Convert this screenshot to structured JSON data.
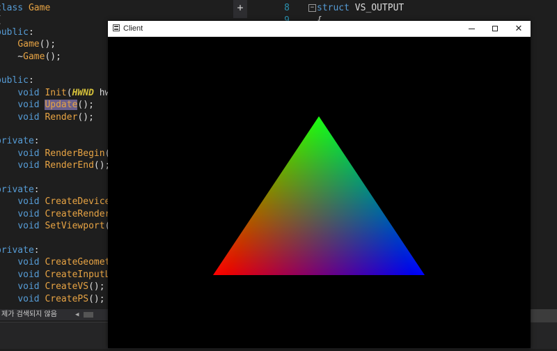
{
  "editor_left": {
    "lines": [
      {
        "segs": [
          {
            "t": "class ",
            "c": "kw"
          },
          {
            "t": "Game",
            "c": "fn"
          }
        ]
      },
      {
        "segs": [
          {
            "t": "{",
            "c": ""
          }
        ]
      },
      {
        "segs": [
          {
            "t": "public",
            "c": "kw"
          },
          {
            "t": ":",
            "c": ""
          }
        ]
      },
      {
        "segs": [
          {
            "t": "    ",
            "c": ""
          },
          {
            "t": "Game",
            "c": "fn"
          },
          {
            "t": "();",
            "c": ""
          }
        ]
      },
      {
        "segs": [
          {
            "t": "    ~",
            "c": ""
          },
          {
            "t": "Game",
            "c": "fn"
          },
          {
            "t": "();",
            "c": ""
          }
        ]
      },
      {
        "segs": []
      },
      {
        "segs": [
          {
            "t": "public",
            "c": "kw"
          },
          {
            "t": ":",
            "c": ""
          }
        ]
      },
      {
        "segs": [
          {
            "t": "    ",
            "c": ""
          },
          {
            "t": "void ",
            "c": "kw"
          },
          {
            "t": "Init",
            "c": "fn"
          },
          {
            "t": "(",
            "c": ""
          },
          {
            "t": "HWND",
            "c": "macro"
          },
          {
            "t": " hwnd",
            "c": ""
          }
        ]
      },
      {
        "segs": [
          {
            "t": "    ",
            "c": ""
          },
          {
            "t": "void ",
            "c": "kw"
          },
          {
            "t": "Update",
            "c": "hl"
          },
          {
            "t": "();",
            "c": ""
          }
        ]
      },
      {
        "segs": [
          {
            "t": "    ",
            "c": ""
          },
          {
            "t": "void ",
            "c": "kw"
          },
          {
            "t": "Render",
            "c": "fn"
          },
          {
            "t": "();",
            "c": ""
          }
        ]
      },
      {
        "segs": []
      },
      {
        "segs": [
          {
            "t": "private",
            "c": "kw"
          },
          {
            "t": ":",
            "c": ""
          }
        ]
      },
      {
        "segs": [
          {
            "t": "    ",
            "c": ""
          },
          {
            "t": "void ",
            "c": "kw"
          },
          {
            "t": "RenderBegin",
            "c": "fn"
          },
          {
            "t": "()",
            "c": ""
          }
        ]
      },
      {
        "segs": [
          {
            "t": "    ",
            "c": ""
          },
          {
            "t": "void ",
            "c": "kw"
          },
          {
            "t": "RenderEnd",
            "c": "fn"
          },
          {
            "t": "();",
            "c": ""
          }
        ]
      },
      {
        "segs": []
      },
      {
        "segs": [
          {
            "t": "private",
            "c": "kw"
          },
          {
            "t": ":",
            "c": ""
          }
        ]
      },
      {
        "segs": [
          {
            "t": "    ",
            "c": ""
          },
          {
            "t": "void ",
            "c": "kw"
          },
          {
            "t": "CreateDeviceA",
            "c": "fn"
          }
        ]
      },
      {
        "segs": [
          {
            "t": "    ",
            "c": ""
          },
          {
            "t": "void ",
            "c": "kw"
          },
          {
            "t": "CreateRenderT",
            "c": "fn"
          }
        ]
      },
      {
        "segs": [
          {
            "t": "    ",
            "c": ""
          },
          {
            "t": "void ",
            "c": "kw"
          },
          {
            "t": "SetViewport",
            "c": "fn"
          },
          {
            "t": "()",
            "c": ""
          }
        ]
      },
      {
        "segs": []
      },
      {
        "segs": [
          {
            "t": "private",
            "c": "kw"
          },
          {
            "t": ":",
            "c": ""
          }
        ]
      },
      {
        "segs": [
          {
            "t": "    ",
            "c": ""
          },
          {
            "t": "void ",
            "c": "kw"
          },
          {
            "t": "CreateGeometr",
            "c": "fn"
          }
        ]
      },
      {
        "segs": [
          {
            "t": "    ",
            "c": ""
          },
          {
            "t": "void ",
            "c": "kw"
          },
          {
            "t": "CreateInputLa",
            "c": "fn"
          }
        ]
      },
      {
        "segs": [
          {
            "t": "    ",
            "c": ""
          },
          {
            "t": "void ",
            "c": "kw"
          },
          {
            "t": "CreateVS",
            "c": "fn"
          },
          {
            "t": "();",
            "c": ""
          }
        ]
      },
      {
        "segs": [
          {
            "t": "    ",
            "c": ""
          },
          {
            "t": "void ",
            "c": "kw"
          },
          {
            "t": "CreatePS",
            "c": "fn"
          },
          {
            "t": "();",
            "c": ""
          }
        ]
      }
    ],
    "status_text": "제가 검색되지 않음"
  },
  "editor_right": {
    "lines": [
      {
        "num": "8",
        "fold": "−",
        "code": "struct VS_OUTPUT"
      },
      {
        "num": "9",
        "fold": "",
        "code": "{"
      }
    ]
  },
  "client_window": {
    "title": "Client",
    "clear_color": "#000000",
    "triangle": {
      "top_color": "#00ff00",
      "left_color": "#ff0000",
      "right_color": "#0000ff"
    }
  },
  "colors": {
    "keyword": "#569cd6",
    "function": "#e8a444",
    "line_number": "#2b91af"
  }
}
